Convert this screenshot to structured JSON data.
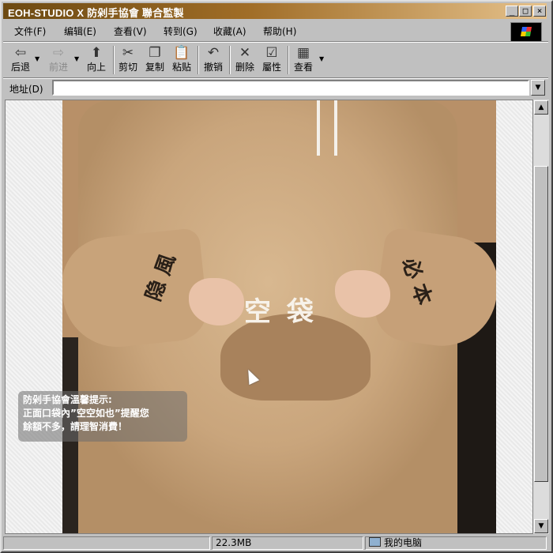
{
  "window": {
    "title": "EOH-STUDIO X 防剁手協會 聯合監製",
    "controls": {
      "minimize": "_",
      "maximize": "□",
      "close": "×"
    }
  },
  "menu": {
    "items": [
      "文件(F)",
      "编辑(E)",
      "查看(V)",
      "转到(G)",
      "收藏(A)",
      "帮助(H)"
    ]
  },
  "toolbar": {
    "back": {
      "label": "后退",
      "icon": "back-arrow-icon",
      "glyph": "⇦"
    },
    "forward": {
      "label": "前进",
      "icon": "forward-arrow-icon",
      "glyph": "⇨"
    },
    "up": {
      "label": "向上",
      "icon": "up-folder-icon",
      "glyph": "⬆"
    },
    "cut": {
      "label": "剪切",
      "icon": "scissors-icon",
      "glyph": "✂"
    },
    "copy": {
      "label": "复制",
      "icon": "copy-icon",
      "glyph": "❐"
    },
    "paste": {
      "label": "粘贴",
      "icon": "clipboard-icon",
      "glyph": "📋"
    },
    "undo": {
      "label": "撤销",
      "icon": "undo-icon",
      "glyph": "↶"
    },
    "delete": {
      "label": "删除",
      "icon": "delete-x-icon",
      "glyph": "✕"
    },
    "properties": {
      "label": "屬性",
      "icon": "properties-icon",
      "glyph": "☑"
    },
    "views": {
      "label": "查看",
      "icon": "view-grid-icon",
      "glyph": "▦"
    }
  },
  "address": {
    "label": "地址(D)",
    "value": ""
  },
  "content": {
    "cuff_left": "隐 風",
    "cuff_right": "必 本",
    "pocket_text": "空 袋",
    "notice_lines": [
      "防剁手協會溫馨提示:",
      "正面口袋內”空空如也”提醒您",
      "餘額不多，請理智消費！"
    ]
  },
  "status": {
    "size": "22.3MB",
    "location": "我的电脑"
  },
  "colors": {
    "title_gradient_start": "#6d4a12",
    "title_gradient_end": "#e6c28c",
    "chrome": "#c0c0c0",
    "hoodie": "#c9a57c"
  }
}
